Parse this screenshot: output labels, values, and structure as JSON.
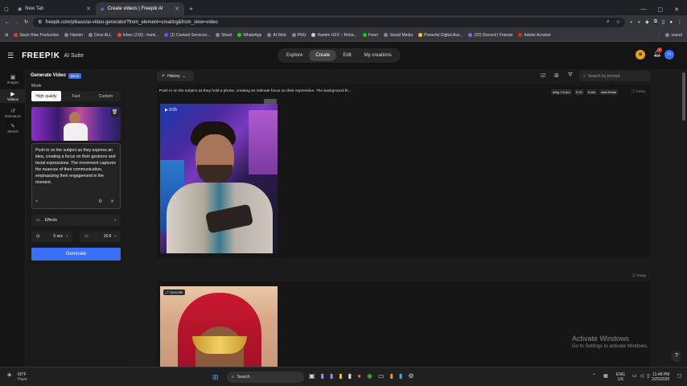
{
  "browser": {
    "tabs": [
      {
        "label": "New Tab"
      },
      {
        "label": "Create videos | Freepik AI"
      }
    ],
    "url": "freepik.com/pikaso/ai-video-generator?from_element=creating&from_view=video",
    "bookmarks": [
      "Stack Rise Productive",
      "Hamim",
      "Drive ALL",
      "Inbox (215) - hami...",
      "(1) Content Services...",
      "Sheet",
      "WhatsApp",
      "AI Web",
      "PNG",
      "Hamim GFX :: Reha...",
      "Fiverr",
      "Social Media",
      "Powerful Digital Ass...",
      "(22) Discord | Friends",
      "Adobe Acrobat"
    ],
    "bookmarks_end": "sound"
  },
  "app": {
    "logo": "FREEP!K",
    "suite": "AI Suite",
    "nav": [
      "Explore",
      "Create",
      "Edit",
      "My creations"
    ],
    "rail": [
      {
        "label": "Images"
      },
      {
        "label": "Videos"
      },
      {
        "label": "Retexture"
      },
      {
        "label": "Sketch"
      }
    ],
    "badge_count": "1"
  },
  "panel": {
    "title": "Generate Video",
    "beta": "BETA",
    "mode_label": "Mode",
    "modes": [
      "High quality",
      "Fast",
      "Custom"
    ],
    "prompt": "Push in on the subject as they express an idea, creating a focus on their gestures and facial expressions. The movement captures the nuances of their communication, emphasizing their engagement in the moment.",
    "effects": "Effects",
    "duration": "5 sec",
    "ratio": "16:9",
    "generate": "Generate"
  },
  "main": {
    "history": "History",
    "search_placeholder": "Search by prompt",
    "gen1": {
      "prompt": "Push in on the subject as they hold a phone, creating an intimate focus on their expression. The background fe...",
      "tags": [
        "kling 1.6 pro",
        "9:16",
        "5 sec",
        "start frame"
      ],
      "date": "Today",
      "time": "0:05"
    },
    "gen2": {
      "date": "Today",
      "badge": "Upscale"
    }
  },
  "watermark": {
    "title": "Activate Windows",
    "sub": "Go to Settings to activate Windows."
  },
  "taskbar": {
    "temp": "60°F",
    "weather": "Haze",
    "search": "Search",
    "lang": "ENG",
    "region": "US",
    "time": "11:48 PM",
    "date": "2/25/2025"
  },
  "colors": {
    "accent": "#3b6ff5",
    "bg": "#1b1b1b"
  }
}
